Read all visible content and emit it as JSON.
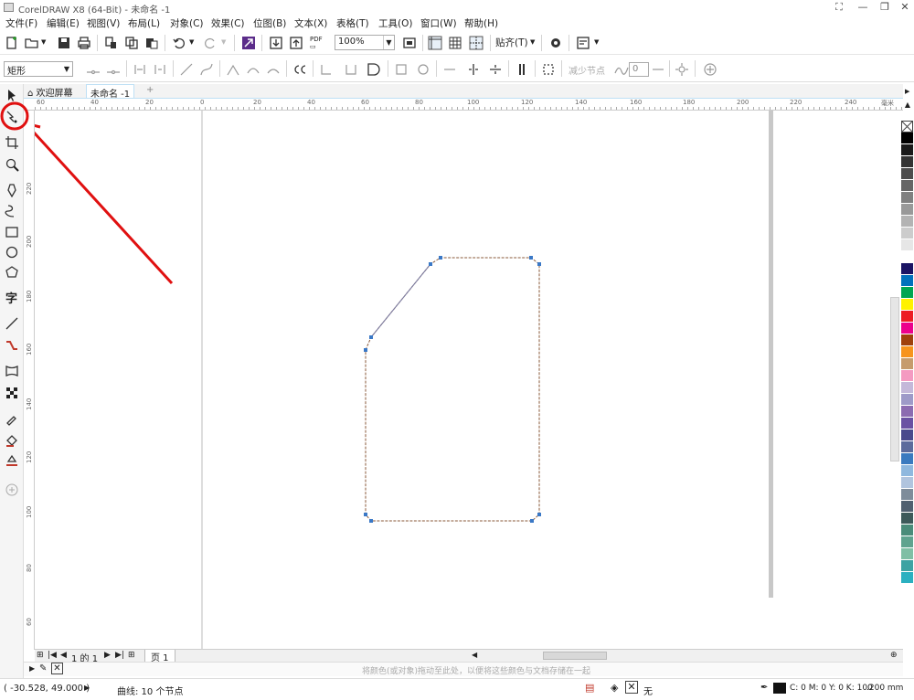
{
  "window": {
    "title": "CorelDRAW X8 (64-Bit) - 未命名 -1"
  },
  "menu": [
    "文件(F)",
    "编辑(E)",
    "视图(V)",
    "布局(L)",
    "对象(C)",
    "效果(C)",
    "位图(B)",
    "文本(X)",
    "表格(T)",
    "工具(O)",
    "窗口(W)",
    "帮助(H)"
  ],
  "toolbar": {
    "zoom": "100%",
    "snap_label": "贴齐(T)",
    "pdf_label": "PDF"
  },
  "property_bar": {
    "shape_type": "矩形",
    "reduce_nodes": "减少节点",
    "smoothness": "0"
  },
  "tabs": {
    "welcome": "欢迎屏幕",
    "doc": "未命名 -1"
  },
  "ruler": {
    "unit": "毫米",
    "h_ticks": [
      "60",
      "40",
      "20",
      "0",
      "20",
      "40",
      "60",
      "80",
      "100",
      "120",
      "140",
      "160",
      "180",
      "200",
      "220",
      "240"
    ],
    "v_ticks": [
      "220",
      "200",
      "180",
      "160",
      "140",
      "120",
      "100",
      "80",
      "60"
    ]
  },
  "pagebar": {
    "page_of": "1 的 1",
    "page_tab": "页 1"
  },
  "hint": "将颜色(或对象)拖动至此处，以便将这些颜色与文档存储在一起",
  "status": {
    "coords": "( -30.528, 49.000 )",
    "object_info": "曲线: 10 个节点",
    "fill_none": "无",
    "outline_color": "C: 0 M: 0 Y: 0 K: 100",
    "outline_width": ".200 mm"
  },
  "palette": [
    "#000000",
    "#1a1a1a",
    "#333333",
    "#4d4d4d",
    "#666666",
    "#808080",
    "#999999",
    "#b3b3b3",
    "#cccccc",
    "#e6e6e6",
    "#ffffff",
    "#1b1464",
    "#0071bc",
    "#00a651",
    "#fff200",
    "#ed1c24",
    "#ec008c",
    "#a0410d",
    "#f7941d",
    "#c69c6d",
    "#f49ac1",
    "#c4b8d9",
    "#9e9ac8",
    "#8c6bb1",
    "#6a51a3",
    "#4a4a8c",
    "#5c6b9c",
    "#3a7abf",
    "#8fb8de",
    "#b0c4de",
    "#7e8c9a",
    "#506070",
    "#3d5a5a",
    "#4a8c7a",
    "#5fa38f",
    "#7fbfa5",
    "#3da3a3",
    "#2bb0c0"
  ],
  "icons": [
    "pick-tool-icon",
    "shape-tool-icon",
    "crop-tool-icon",
    "zoom-tool-icon",
    "freehand-tool-icon",
    "artistic-media-icon",
    "rectangle-tool-icon",
    "ellipse-tool-icon",
    "polygon-tool-icon",
    "text-tool-icon",
    "parallel-dimension-icon",
    "connector-icon",
    "envelope-icon",
    "transparency-icon",
    "eyedropper-icon",
    "interactive-fill-icon",
    "smart-fill-icon",
    "add-icon"
  ]
}
